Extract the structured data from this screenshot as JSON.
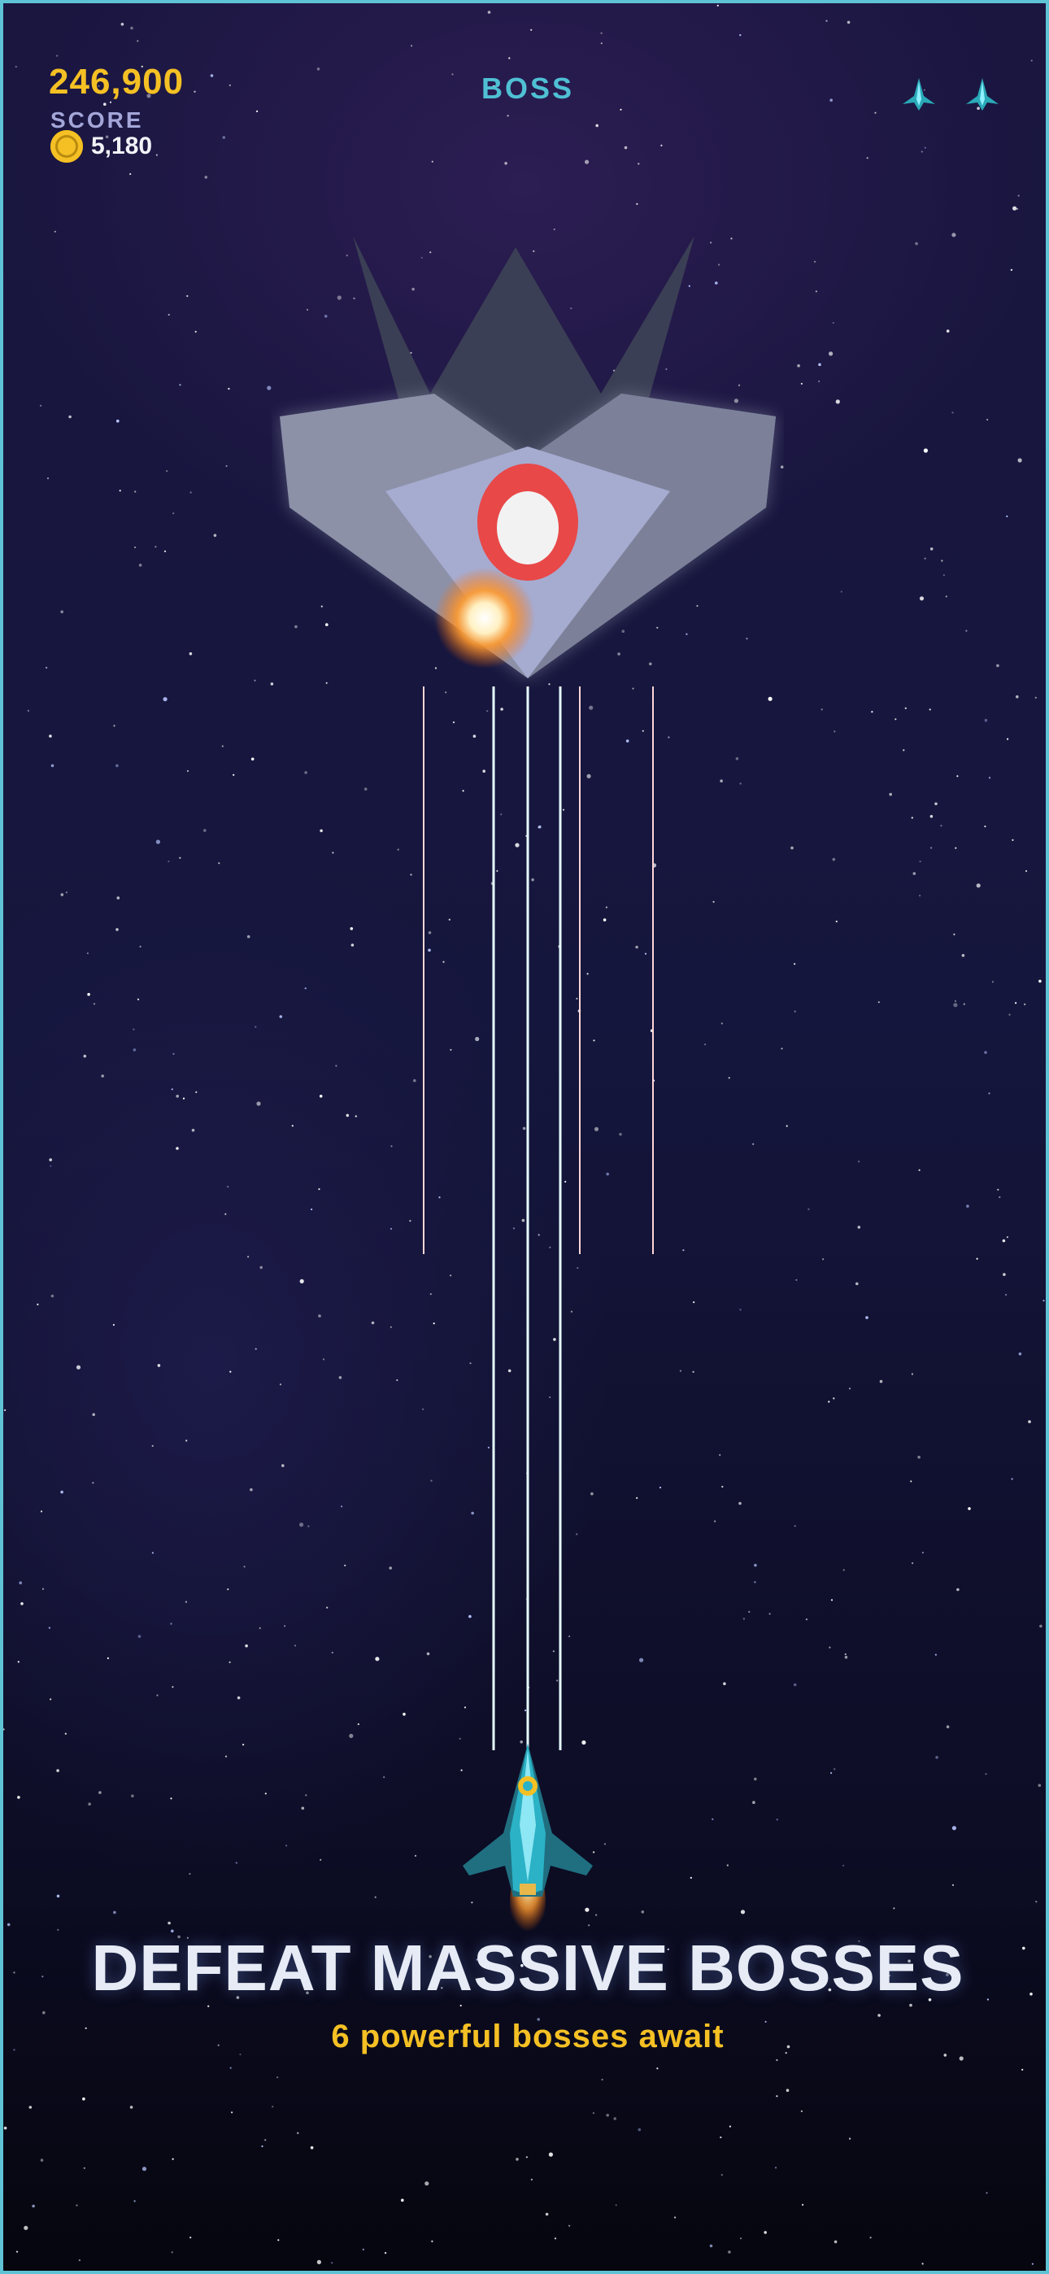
{
  "hud": {
    "score": "246,900",
    "score_label": "SCORE",
    "coins": "5,180",
    "coin_icon": "coin-icon",
    "stage_label": "BOSS",
    "lives": 2,
    "life_icon": "ship-life-icon"
  },
  "promo": {
    "headline": "DEFEAT MASSIVE BOSSES",
    "subline": "6 powerful bosses await"
  },
  "colors": {
    "accent_gold": "#f5c024",
    "accent_cyan": "#4fc0d4",
    "enemy_laser": "#ff3b3b",
    "player_laser": "#7ff6ff",
    "boss_hull": "#8c91a8",
    "boss_core": "#e84848"
  }
}
